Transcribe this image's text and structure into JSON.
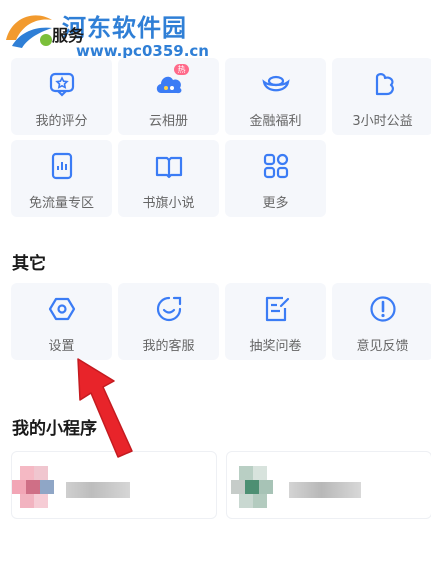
{
  "watermark": {
    "site_name": "河东软件园",
    "url": "www.pc0359.cn"
  },
  "sections": {
    "services": {
      "title": "服务",
      "tiles": [
        {
          "label": "我的评分",
          "icon": "rating-icon"
        },
        {
          "label": "云相册",
          "icon": "cloud-album-icon",
          "badge": "热"
        },
        {
          "label": "金融福利",
          "icon": "gold-ingot-icon"
        },
        {
          "label": "3小时公益",
          "icon": "charity-icon"
        },
        {
          "label": "免流量专区",
          "icon": "data-free-icon"
        },
        {
          "label": "书旗小说",
          "icon": "book-icon"
        },
        {
          "label": "更多",
          "icon": "more-grid-icon"
        }
      ]
    },
    "other": {
      "title": "其它",
      "tiles": [
        {
          "label": "设置",
          "icon": "settings-icon"
        },
        {
          "label": "我的客服",
          "icon": "customer-service-icon"
        },
        {
          "label": "抽奖问卷",
          "icon": "survey-icon"
        },
        {
          "label": "意见反馈",
          "icon": "feedback-icon"
        }
      ]
    },
    "mini_programs": {
      "title": "我的小程序"
    }
  },
  "colors": {
    "accent": "#3b7cf5",
    "tile_bg": "#f5f7fb",
    "arrow": "#e8242a"
  }
}
